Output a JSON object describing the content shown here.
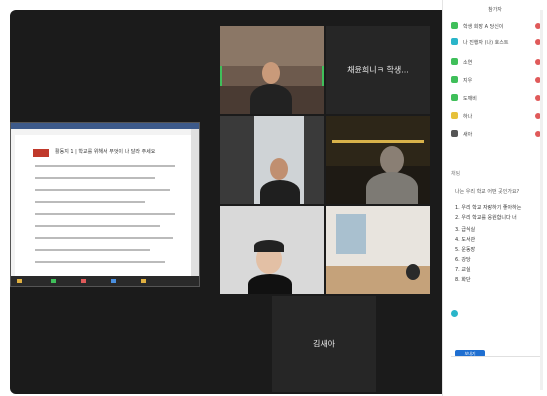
{
  "tiles": {
    "speaker": {
      "label": ""
    },
    "name_only_1": {
      "name": "채윤희니ㅋ 학생..."
    },
    "name_only_2": {
      "name": "김새아"
    }
  },
  "shared_doc": {
    "title": "활동지 1 | 학교를 위해서 무엇이 나 달라 주세요"
  },
  "panel": {
    "title": "참가자",
    "participants": [
      {
        "name": "학생 회장 A 당신이",
        "color": "#3fbf5a",
        "mic": "#e05a5a"
      },
      {
        "name": "나 진행자 (나) 호스트",
        "color": "#2ab5c9",
        "mic": "#e05a5a"
      },
      {
        "name": "소연",
        "color": "#3fbf5a",
        "mic": "#e05a5a"
      },
      {
        "name": "지우",
        "color": "#3fbf5a",
        "mic": "#e05a5a"
      },
      {
        "name": "도깨비",
        "color": "#3fbf5a",
        "mic": "#e05a5a"
      },
      {
        "name": "하나",
        "color": "#e6c13a",
        "mic": "#e05a5a"
      },
      {
        "name": "새아",
        "color": "#555555",
        "mic": "#e05a5a"
      }
    ],
    "chat_tab": "채팅",
    "chat_header": "나는 우리 학교 어떤 곳인가요?",
    "chat_lines": [
      "1. 우리 학교 자랑하기 좋아하는",
      "2. 우리 학교를 응원합니다 너",
      "3. 급식실",
      "4. 도서관",
      "5. 운동장",
      "6. 강당",
      "7. 교실",
      "8. 화단"
    ],
    "chat_footer": "보내기"
  }
}
